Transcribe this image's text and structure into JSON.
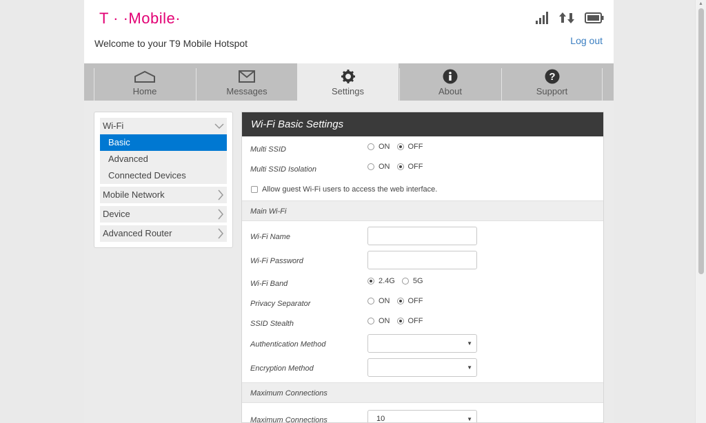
{
  "header": {
    "brand": "T · ·Mobile·",
    "welcome": "Welcome to your T9 Mobile Hotspot",
    "logout": "Log out",
    "brand_color": "#e20074"
  },
  "status": {
    "icons": [
      "signal-icon",
      "data-transfer-icon",
      "battery-icon"
    ]
  },
  "nav": {
    "tabs": [
      {
        "label": "Home",
        "icon": "home-icon"
      },
      {
        "label": "Messages",
        "icon": "envelope-icon"
      },
      {
        "label": "Settings",
        "icon": "gear-icon"
      },
      {
        "label": "About",
        "icon": "info-icon"
      },
      {
        "label": "Support",
        "icon": "question-icon"
      }
    ],
    "active": "Settings"
  },
  "sidebar": {
    "wifi": "Wi-Fi",
    "sub": [
      "Basic",
      "Advanced",
      "Connected Devices"
    ],
    "mobile_network": "Mobile Network",
    "device": "Device",
    "advanced_router": "Advanced Router",
    "active_color": "#0078d2"
  },
  "panel": {
    "title": "Wi-Fi Basic Settings",
    "multi_ssid": {
      "label": "Multi SSID",
      "on": "ON",
      "off": "OFF",
      "selected": "OFF"
    },
    "multi_ssid_isolation": {
      "label": "Multi SSID Isolation",
      "on": "ON",
      "off": "OFF",
      "selected": "OFF"
    },
    "guest_access": {
      "label": "Allow guest Wi-Fi users to access the web interface.",
      "checked": false
    },
    "main_wifi": {
      "title": "Main Wi-Fi",
      "wifi_name": {
        "label": "Wi-Fi Name",
        "value": ""
      },
      "wifi_password": {
        "label": "Wi-Fi Password",
        "value": ""
      },
      "wifi_band": {
        "label": "Wi-Fi Band",
        "opt1": "2.4G",
        "opt2": "5G",
        "selected": "2.4G"
      },
      "privacy_separator": {
        "label": "Privacy Separator",
        "on": "ON",
        "off": "OFF",
        "selected": "OFF"
      },
      "ssid_stealth": {
        "label": "SSID Stealth",
        "on": "ON",
        "off": "OFF",
        "selected": "OFF"
      },
      "auth_method": {
        "label": "Authentication Method",
        "value": ""
      },
      "encryption_method": {
        "label": "Encryption Method",
        "value": ""
      }
    },
    "max_connections": {
      "title": "Maximum Connections",
      "label": "Maximum Connections",
      "value": "10"
    }
  }
}
